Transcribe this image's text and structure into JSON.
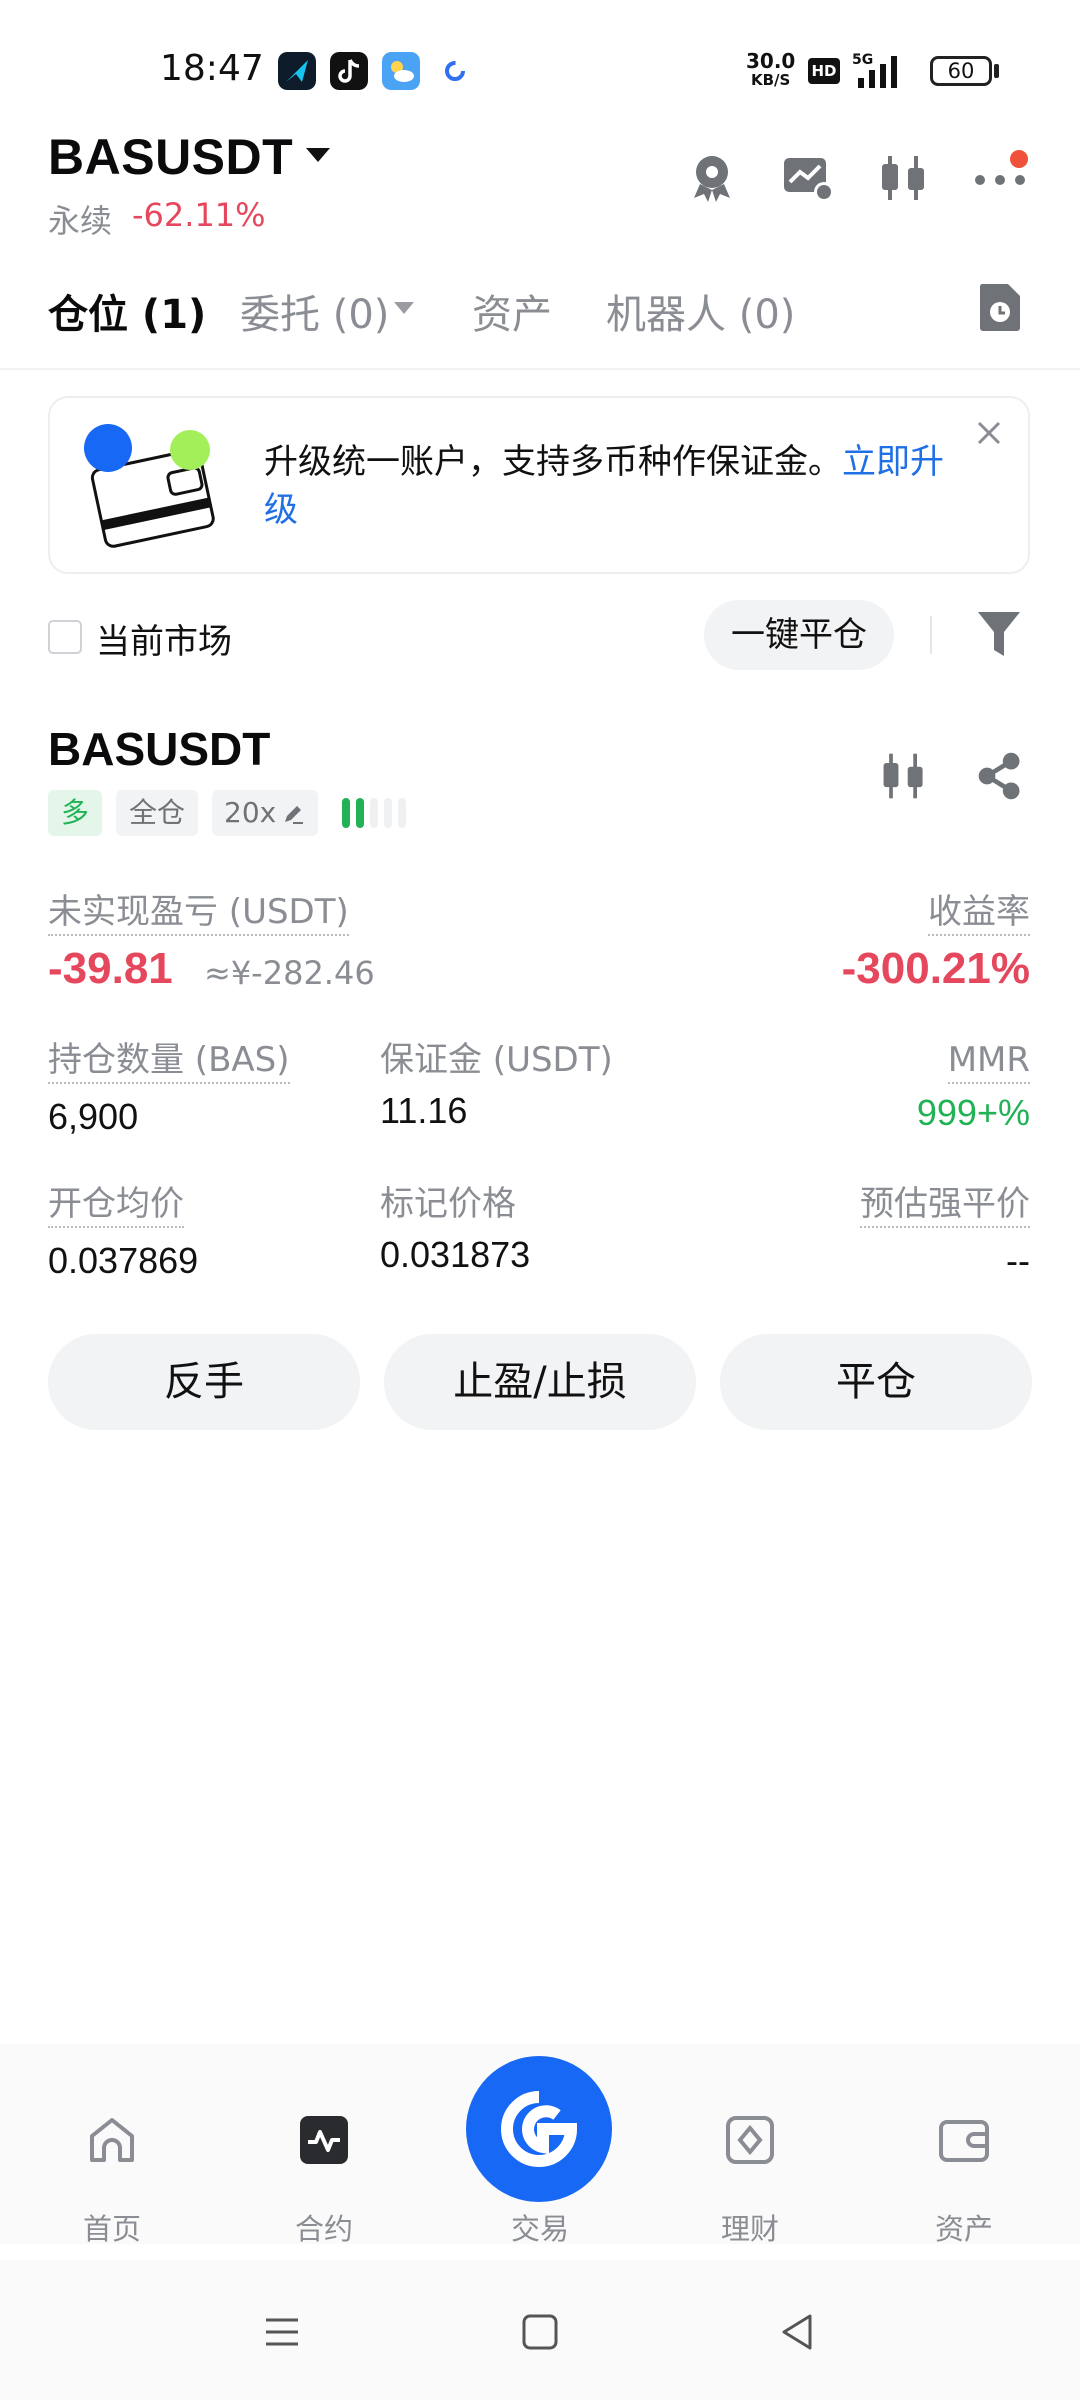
{
  "status_bar": {
    "time": "18:47",
    "net_speed_value": "30.0",
    "net_speed_unit": "KB/S",
    "hd_label": "HD",
    "signal_label": "5G",
    "battery": "60",
    "app_icons": [
      "maps-icon",
      "tiktok-icon",
      "weather-icon",
      "sync-icon"
    ]
  },
  "header": {
    "pair": "BASUSDT",
    "contract_type": "永续",
    "change": "-62.11%"
  },
  "tabs": [
    {
      "label": "仓位 (1)",
      "active": true
    },
    {
      "label": "委托 (0)",
      "active": false
    },
    {
      "label": "资产",
      "active": false
    },
    {
      "label": "机器人 (0)",
      "active": false
    }
  ],
  "banner": {
    "text": "升级统一账户，支持多币种作保证金。",
    "link": "立即升级"
  },
  "filter": {
    "current_market_label": "当前市场",
    "close_all_label": "一键平仓"
  },
  "position": {
    "symbol": "BASUSDT",
    "side": "多",
    "margin_mode": "全仓",
    "leverage": "20x",
    "unrealized_pnl_label": "未实现盈亏 (USDT)",
    "unrealized_pnl": "-39.81",
    "unrealized_pnl_cny": "≈¥-282.46",
    "roe_label": "收益率",
    "roe": "-300.21%",
    "size_label": "持仓数量 (BAS)",
    "size": "6,900",
    "margin_label": "保证金 (USDT)",
    "margin": "11.16",
    "mmr_label": "MMR",
    "mmr": "999+%",
    "entry_label": "开仓均价",
    "entry": "0.037869",
    "mark_label": "标记价格",
    "mark": "0.031873",
    "liq_label": "预估强平价",
    "liq": "--",
    "buttons": {
      "reverse": "反手",
      "tpsl": "止盈/止损",
      "close": "平仓"
    }
  },
  "bottom_nav": [
    {
      "label": "首页",
      "icon": "home-icon"
    },
    {
      "label": "合约",
      "icon": "futures-icon"
    },
    {
      "label": "交易",
      "icon": "trade-icon"
    },
    {
      "label": "理财",
      "icon": "earn-icon"
    },
    {
      "label": "资产",
      "icon": "wallet-icon"
    }
  ],
  "colors": {
    "accent": "#1768f5",
    "negative": "#e5485d",
    "positive": "#20b254"
  }
}
